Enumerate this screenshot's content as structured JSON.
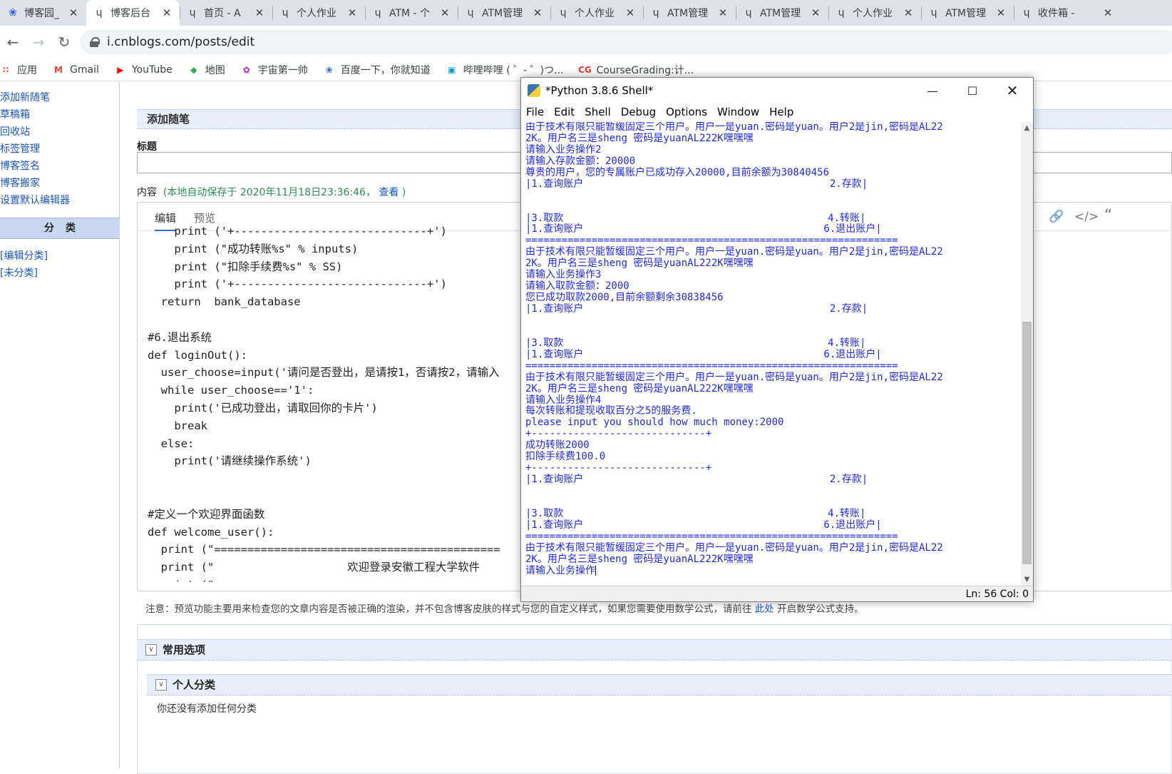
{
  "browser": {
    "tabs": [
      {
        "title": "博客园_",
        "active": false
      },
      {
        "title": "博客后台",
        "active": true
      },
      {
        "title": "首页 - A",
        "active": false
      },
      {
        "title": "个人作业",
        "active": false
      },
      {
        "title": "ATM - 个",
        "active": false
      },
      {
        "title": "ATM管理",
        "active": false
      },
      {
        "title": "个人作业",
        "active": false
      },
      {
        "title": "ATM管理",
        "active": false
      },
      {
        "title": "ATM管理",
        "active": false
      },
      {
        "title": "个人作业",
        "active": false
      },
      {
        "title": "ATM管理",
        "active": false
      },
      {
        "title": "收件箱 -",
        "active": false
      }
    ],
    "url": "i.cnblogs.com/posts/edit",
    "bookmarks": [
      {
        "label": "应用",
        "icon": "apps-grid-icon"
      },
      {
        "label": "Gmail",
        "icon": "gmail-icon"
      },
      {
        "label": "YouTube",
        "icon": "youtube-icon"
      },
      {
        "label": "地图",
        "icon": "maps-icon"
      },
      {
        "label": "宇宙第一帅",
        "icon": "flower-icon"
      },
      {
        "label": "百度一下，你就知道",
        "icon": "baidu-paw-icon"
      },
      {
        "label": "哔哩哔哩 ( ゜- ゜)つ...",
        "icon": "bilibili-icon"
      },
      {
        "label": "CourseGrading:计...",
        "icon": "cg-icon"
      }
    ]
  },
  "sidebar": {
    "links": [
      "添加新随笔",
      "草稿箱",
      "回收站",
      "标签管理",
      "博客签名",
      "博客搬家",
      "设置默认编辑器"
    ],
    "category_header": "分类",
    "categories": [
      "[编辑分类]",
      "[未分类]"
    ]
  },
  "main": {
    "header": "添加随笔",
    "title_label": "标题",
    "content_label": "内容",
    "autosave_prefix": "(本地自动保存于 2020年11月18日23:36:46，",
    "autosave_link": "查看",
    "autosave_suffix": ")",
    "editor_tabs": [
      "编辑",
      "预览"
    ],
    "code_lines": [
      "    print ('+-----------------------------+')",
      "    print (\"成功转账%s\" % inputs)",
      "    print (\"扣除手续费%s\" % SS)",
      "    print ('+-----------------------------+')",
      "  return  bank_database",
      "",
      "#6.退出系统",
      "def loginOut():",
      "  user_choose=input('请问是否登出，是请按1，否请按2，请输入",
      "  while user_choose=='1':",
      "    print('已成功登出，请取回你的卡片')",
      "    break",
      "  else:",
      "    print('请继续操作系统')",
      "",
      "",
      "#定义一个欢迎界面函数",
      "def welcome_user():",
      "  print (\"===========================================",
      "  print (\"                    欢迎登录安徽工程大学软件",
      "  print (\"==========================================="
    ],
    "note_prefix": "注意：预览功能主要用来检查您的文章内容是否被正确的渲染，并不包含博客皮肤的样式与您的自定义样式，如果您需要使用数学公式，请前往",
    "note_link": "此处",
    "note_suffix": "开启数学公式支持。",
    "section_common": "常用选项",
    "section_personal": "个人分类",
    "no_category": "你还没有添加任何分类"
  },
  "shell": {
    "title": "*Python 3.8.6 Shell*",
    "menu": [
      "File",
      "Edit",
      "Shell",
      "Debug",
      "Options",
      "Window",
      "Help"
    ],
    "lines": [
      "由于技术有限只能暂缓固定三个用户。用户一是yuan.密码是yuan。用户2是jin,密码是AL22",
      "2K。用户名三是sheng 密码是yuanAL222K嘿嘿嘿",
      "请输入业务操作2",
      "请输入存款金额：20000",
      "尊贵的用户，您的专属账户已成功存入20000,目前余额为30840456",
      "|1.查询账户                                         2.存款|",
      "",
      "",
      "|3.取款                                            4.转账|",
      "|1.查询账户                                        6.退出账户|",
      "==============================================================",
      "由于技术有限只能暂缓固定三个用户。用户一是yuan.密码是yuan。用户2是jin,密码是AL22",
      "2K。用户名三是sheng 密码是yuanAL222K嘿嘿嘿",
      "请输入业务操作3",
      "请输入取款金额：2000",
      "您已成功取款2000,目前余额剩余30838456",
      "|1.查询账户                                         2.存款|",
      "",
      "",
      "|3.取款                                            4.转账|",
      "|1.查询账户                                        6.退出账户|",
      "==============================================================",
      "由于技术有限只能暂缓固定三个用户。用户一是yuan.密码是yuan。用户2是jin,密码是AL22",
      "2K。用户名三是sheng 密码是yuanAL222K嘿嘿嘿",
      "请输入业务操作4",
      "每次转账和提现收取百分之5的服务费.",
      "please input you should how much money:2000",
      "+-----------------------------+",
      "成功转账2000",
      "扣除手续费100.0",
      "+-----------------------------+",
      "|1.查询账户                                         2.存款|",
      "",
      "",
      "|3.取款                                            4.转账|",
      "|1.查询账户                                        6.退出账户|",
      "==============================================================",
      "由于技术有限只能暂缓固定三个用户。用户一是yuan.密码是yuan。用户2是jin,密码是AL22",
      "2K。用户名三是sheng 密码是yuanAL222K嘿嘿嘿",
      "请输入业务操作"
    ],
    "status": "Ln: 56  Col: 0"
  },
  "colors": {
    "shell_stdout": "#1f2ad6",
    "link": "#1a55b8",
    "autosave": "#2e8b57"
  }
}
